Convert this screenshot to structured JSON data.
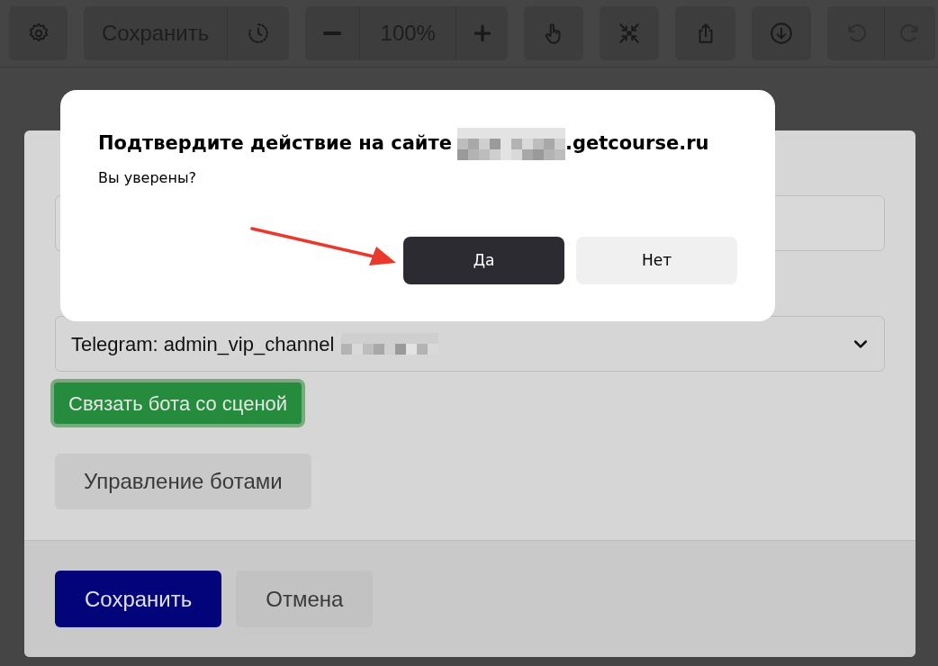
{
  "toolbar": {
    "save_button": "Сохранить",
    "zoom_level": "100%"
  },
  "form": {
    "bot_select": {
      "value": "Telegram: admin_vip_channel"
    },
    "link_button": "Связать бота со сценой",
    "manage_button": "Управление ботами",
    "save_button": "Сохранить",
    "cancel_button": "Отмена"
  },
  "dialog": {
    "title": "Подтвердите действие на сайте",
    "title_domain": ".getcourse.ru",
    "message": "Вы уверены?",
    "buttons": [
      {
        "label": "Да",
        "kind": "primary"
      },
      {
        "label": "Нет",
        "kind": "secondary"
      }
    ]
  }
}
